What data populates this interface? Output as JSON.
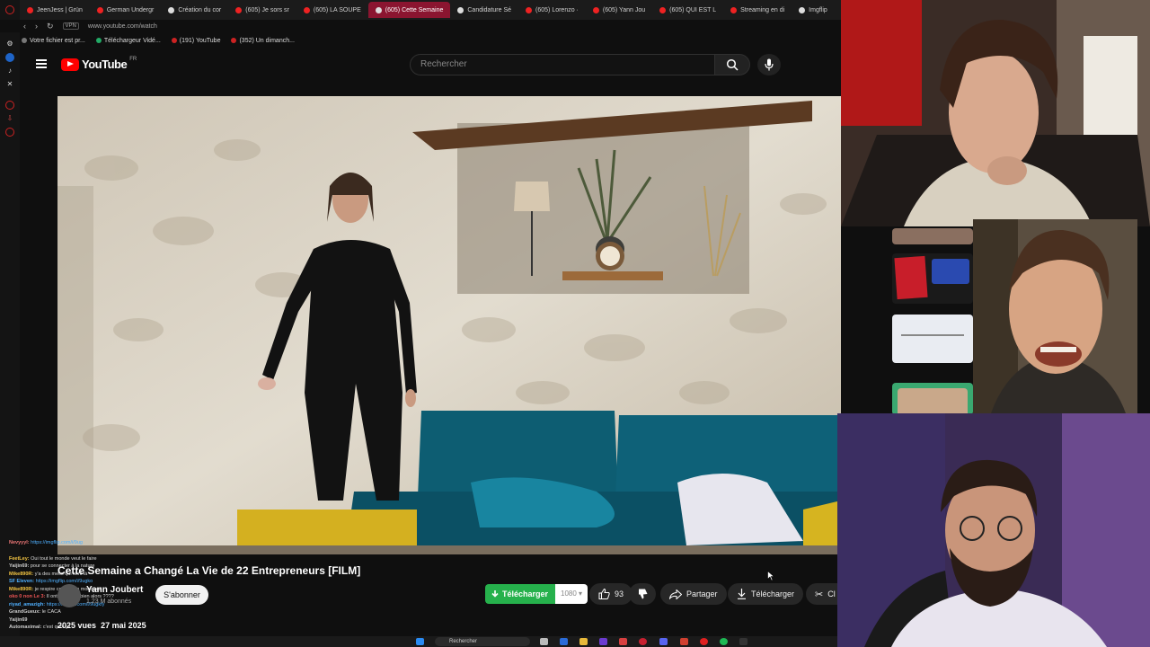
{
  "browser": {
    "tabs": [
      {
        "label": "JeenJess | Grün",
        "icon": "youtube"
      },
      {
        "label": "German Undergr",
        "icon": "youtube"
      },
      {
        "label": "Création du cor",
        "icon": "generic"
      },
      {
        "label": "(605) Je sors sr",
        "icon": "youtube"
      },
      {
        "label": "(605) LA SOUPE",
        "icon": "youtube"
      },
      {
        "label": "(605) Cette Semaine",
        "icon": "youtube",
        "active": true
      },
      {
        "label": "Candidature Sé",
        "icon": "generic"
      },
      {
        "label": "(605) Lorenzo ·",
        "icon": "youtube"
      },
      {
        "label": "(605) Yann Jou",
        "icon": "youtube"
      },
      {
        "label": "(605) QUI EST L",
        "icon": "youtube"
      },
      {
        "label": "Streaming en di",
        "icon": "youtube"
      },
      {
        "label": "Imgflip",
        "icon": "generic"
      }
    ],
    "url": "www.youtube.com/watch",
    "bookmarks": [
      "Votre fichier est pr...",
      "Téléchargeur Vidé...",
      "(191) YouTube",
      "(352) Un dimanch..."
    ]
  },
  "youtube": {
    "logo_text": "YouTube",
    "region": "FR",
    "search_placeholder": "Rechercher"
  },
  "video": {
    "title": "Cette Semaine a Changé La Vie de 22 Entrepreneurs [FILM]",
    "channel": "Yann Joubert",
    "subscribers": "1,23 M abonnés",
    "subscribe_label": "S'abonner",
    "download_green_label": "Télécharger",
    "quality": "1080",
    "likes": "93",
    "share_label": "Partager",
    "download_label": "Télécharger",
    "clip_label": "Cl",
    "views": "2025 vues",
    "date": "27 mai 2025"
  },
  "chat": [
    {
      "user": "Nevyyyl:",
      "text": "https://imgflip.com/i/9ug",
      "color": "#e77"
    },
    {
      "user": "FeetLey:",
      "text": "Oui tout le monde veut le faire",
      "color": "#f4c542"
    },
    {
      "user": "Yaijin69:",
      "text": "pour se connecter à la nature",
      "color": "#ddd"
    },
    {
      "user": "Mike890R:",
      "text": "y'a des mecs qui sont là",
      "color": "#f4c542"
    },
    {
      "user": "SF Eleven:",
      "text": "https://imgflip.com/i/9ugko",
      "color": "#4fb0ff"
    },
    {
      "user": "Mike890R:",
      "text": "je respire comme ça moi aussi",
      "color": "#f4c542"
    },
    {
      "user": "oko 0 non Le 3:",
      "text": "Il ont payé combien alors ????",
      "color": "#e55"
    },
    {
      "user": "riyad_amazigh:",
      "text": "https://imgflip.com/i/9ugkfy",
      "color": "#4fb0ff"
    },
    {
      "user": "GrandGueux:",
      "text": "le CACA",
      "color": "#ddd"
    },
    {
      "user": "Yaijin69",
      "text": "",
      "color": "#ddd"
    },
    {
      "user": "Automaximal:",
      "text": "c'est quoi ça",
      "color": "#ddd"
    }
  ],
  "taskbar": {
    "search_label": "Rechercher"
  },
  "colors": {
    "youtube_red": "#ff0000",
    "download_green": "#26b14c",
    "active_tab": "#8b1530"
  }
}
